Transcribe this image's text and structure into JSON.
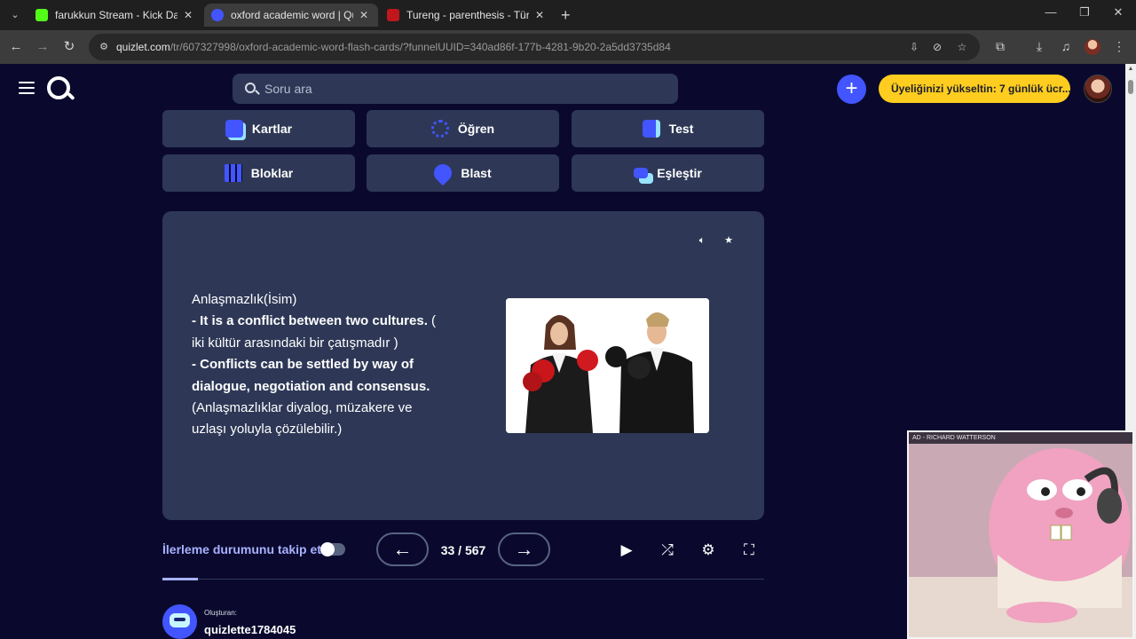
{
  "browser": {
    "tabs": [
      {
        "title": "farukkun Stream - Kick Dashboard",
        "favicon_color": "#53fc18",
        "active": false
      },
      {
        "title": "oxford academic word | Quizlet",
        "favicon_color": "#4255ff",
        "active": true
      },
      {
        "title": "Tureng - parenthesis - Türkçe İngilizce",
        "favicon_color": "#c0171d",
        "active": false
      }
    ],
    "url_host": "quizlet.com",
    "url_path": "/tr/607327998/oxford-academic-word-flash-cards/?funnelUUID=340ad86f-177b-4281-9b20-2a5dd3735d84"
  },
  "header": {
    "search_placeholder": "Soru ara",
    "upgrade_label": "Üyeliğinizi yükseltin: 7 günlük ücr..."
  },
  "modes": [
    {
      "label": "Kartlar",
      "icon": "cards-icon"
    },
    {
      "label": "Öğren",
      "icon": "learn-icon"
    },
    {
      "label": "Test",
      "icon": "test-icon"
    },
    {
      "label": "Bloklar",
      "icon": "blocks-icon"
    },
    {
      "label": "Blast",
      "icon": "blast-icon"
    },
    {
      "label": "Eşleştir",
      "icon": "match-icon"
    }
  ],
  "card": {
    "line1": "Anlaşmazlık(İsim)",
    "line2_bold": "- It is a conflict between two cultures.",
    "line2_rest": " (",
    "line3": "iki kültür arasındaki bir çatışmadır )",
    "line4_bold": "- Conflicts can be settled by way of dialogue, negotiation and consensus.",
    "line5": "(Anlaşmazlıklar diyalog, müzakere ve uzlaşı yoluyla çözülebilir.)"
  },
  "controls": {
    "track_label": "İlerleme durumunu takip et",
    "current": "33",
    "total": "567",
    "separator": " / "
  },
  "creator": {
    "label": "Oluşturan:",
    "name": "quizlette1784045"
  },
  "webcam": {
    "title": "AD - RICHARD WATTERSON"
  }
}
